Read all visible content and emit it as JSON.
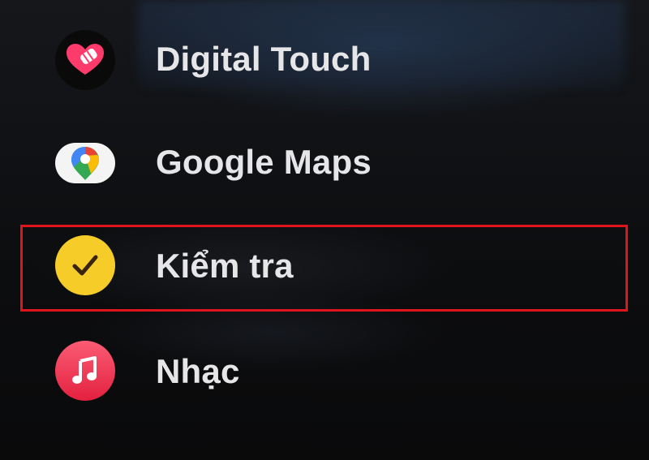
{
  "apps": [
    {
      "label": "Digital Touch",
      "icon": "digital-touch-heart-icon"
    },
    {
      "label": "Google Maps",
      "icon": "google-maps-pin-icon"
    },
    {
      "label": "Kiểm tra",
      "icon": "checkmark-icon"
    },
    {
      "label": "Nhạc",
      "icon": "music-note-icon"
    }
  ],
  "highlight": {
    "target": "Kiểm tra",
    "color": "#e0141c"
  },
  "colors": {
    "background": "#0d0e10",
    "label": "#e6e6e8",
    "check_yellow": "#f5cc28",
    "music_red": "#fb5c74",
    "digital_touch_pink": "#ff3b6b"
  }
}
